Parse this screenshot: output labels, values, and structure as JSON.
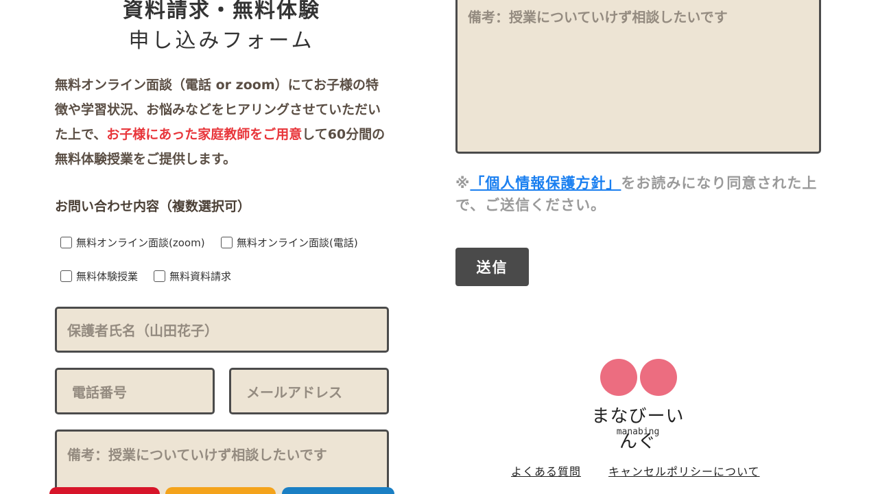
{
  "form": {
    "title_line1": "資料請求・無料体験",
    "title_line2": "申し込みフォーム",
    "intro_part1": "無料オンライン面談（電話 or zoom）にてお子様の特徴や学習状況、お悩みなどをヒアリングさせていただいた上で、",
    "intro_highlight": "お子様にあった家庭教師をご用意",
    "intro_part2": "して60分間の無料体験授業をご提供します。",
    "inquiry_label": "お問い合わせ内容（複数選択可）",
    "options": [
      "無料オンライン面談(zoom)",
      "無料オンライン面談(電話)",
      "無料体験授業",
      "無料資料請求"
    ],
    "guardian_name_placeholder": "保護者氏名（山田花子）",
    "phone_placeholder": "電話番号",
    "email_placeholder": "メールアドレス",
    "notes_placeholder": "備考：授業についていけず相談したいです"
  },
  "consent": {
    "prefix": "※",
    "policy_link": "「個人情報保護方針」",
    "suffix": "をお読みになり同意された上で、ご送信ください。"
  },
  "submit_label": "送信",
  "brand": {
    "name": "まなびーいんぐ",
    "romaji": "manabing",
    "mark_color": "#ec6d80"
  },
  "footer": {
    "faq": "よくある質問",
    "cancel_policy": "キャンセルポリシーについて"
  },
  "colors": {
    "highlight": "#e8353a",
    "field_bg": "#ede4d4",
    "link": "#1a7ff0",
    "button_bg": "#4a4a4a",
    "bar_red": "#d7152a",
    "bar_orange": "#f4a31b",
    "bar_blue": "#1a7fc4"
  }
}
